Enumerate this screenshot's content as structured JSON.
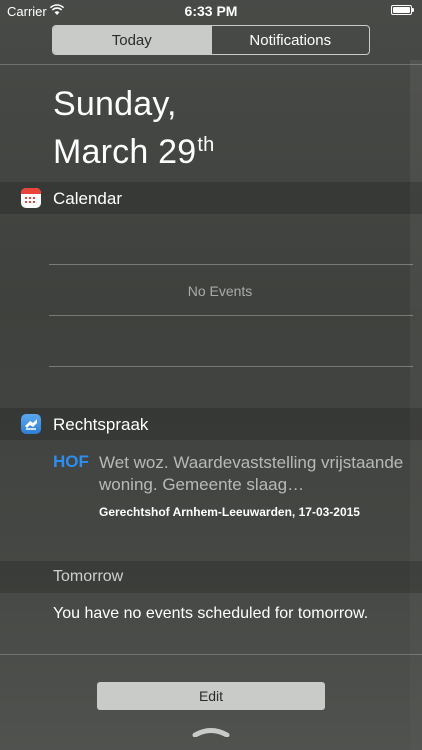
{
  "status_bar": {
    "carrier": "Carrier",
    "time": "6:33 PM"
  },
  "tabs": [
    {
      "label": "Today",
      "active": true
    },
    {
      "label": "Notifications",
      "active": false
    }
  ],
  "date": {
    "weekday": "Sunday,",
    "month_day": "March 29",
    "suffix": "th"
  },
  "calendar": {
    "title": "Calendar",
    "icon": "calendar-icon",
    "empty_text": "No Events"
  },
  "rechtspraak": {
    "title": "Rechtspraak",
    "icon": "rechtspraak-app-icon",
    "item": {
      "badge": "HOF",
      "badge_color": "#2d8ef0",
      "text": "Wet woz. Waardevaststelling vrijstaande woning. Gemeente slaag…",
      "meta": "Gerechtshof Arnhem-Leeuwarden, 17-03-2015"
    }
  },
  "tomorrow": {
    "title": "Tomorrow",
    "text": "You have no events scheduled for tomorrow."
  },
  "edit_label": "Edit"
}
